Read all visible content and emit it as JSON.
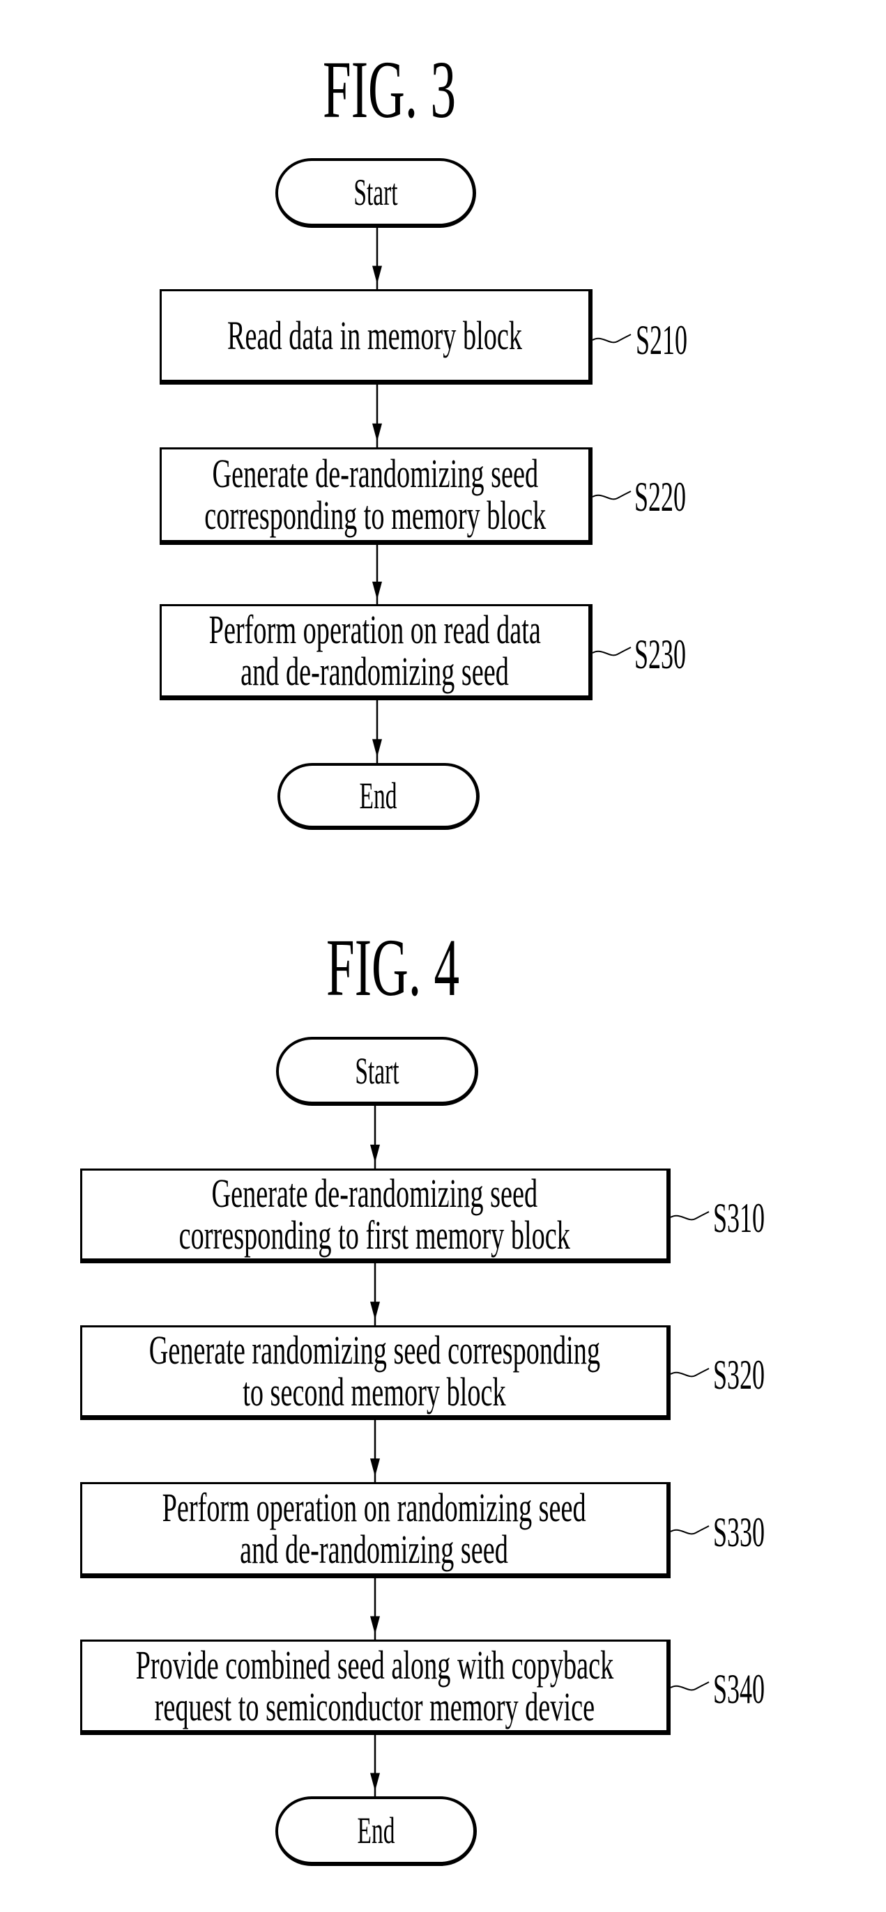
{
  "figures": [
    {
      "title": "FIG. 3",
      "start_label": "Start",
      "end_label": "End",
      "steps": [
        {
          "id": "S210",
          "lines": [
            "Read data in memory block"
          ]
        },
        {
          "id": "S220",
          "lines": [
            "Generate de-randomizing seed",
            "corresponding to memory block"
          ]
        },
        {
          "id": "S230",
          "lines": [
            "Perform operation on read data",
            "and de-randomizing seed"
          ]
        }
      ]
    },
    {
      "title": "FIG. 4",
      "start_label": "Start",
      "end_label": "End",
      "steps": [
        {
          "id": "S310",
          "lines": [
            "Generate de-randomizing seed",
            "corresponding to first memory block"
          ]
        },
        {
          "id": "S320",
          "lines": [
            "Generate randomizing seed corresponding",
            "to second memory block"
          ]
        },
        {
          "id": "S330",
          "lines": [
            "Perform operation on randomizing seed",
            "and de-randomizing seed"
          ]
        },
        {
          "id": "S340",
          "lines": [
            "Provide combined seed along with copyback",
            "request to semiconductor memory device"
          ]
        }
      ]
    }
  ]
}
